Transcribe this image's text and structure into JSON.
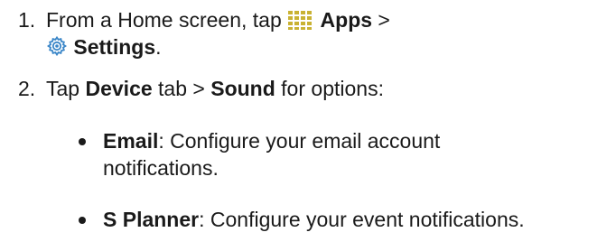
{
  "steps": [
    {
      "number": "1.",
      "line1_prefix": "From a Home screen, tap ",
      "apps_icon": "apps-grid-icon",
      "apps_label": "Apps",
      "separator": " >",
      "settings_icon": "settings-gear-icon",
      "settings_label": "Settings",
      "line2_suffix": "."
    },
    {
      "number": "2.",
      "prefix": "Tap ",
      "device_label": "Device",
      "middle": " tab > ",
      "sound_label": "Sound",
      "suffix": " for options:"
    }
  ],
  "bullets": [
    {
      "term": "Email",
      "line1": ": Configure your email account",
      "line2": "notifications."
    },
    {
      "term": "S Planner",
      "line1": ": Configure your event notifications."
    }
  ],
  "colors": {
    "text": "#1a1a1a",
    "icon_grid": "#c9b233",
    "icon_gear": "#3a86c8"
  }
}
